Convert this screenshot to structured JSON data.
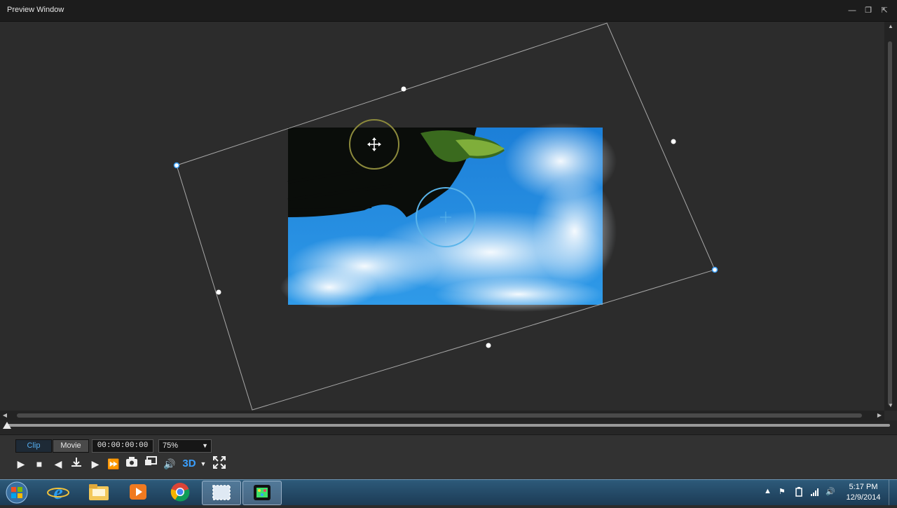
{
  "window": {
    "title": "Preview Window",
    "controls": {
      "minimize": "—",
      "restore": "❐",
      "undock": "⇱"
    }
  },
  "scrollbars": {
    "up": "▲",
    "down": "▼",
    "left": "◀",
    "right": "▶"
  },
  "playback": {
    "clip_label": "Clip",
    "movie_label": "Movie",
    "timecode": "00:00:00:00",
    "zoom_value": "75%",
    "zoom_arrow": "▼",
    "buttons": {
      "play": "▶",
      "stop": "■",
      "prev_frame": "◀",
      "next_frame": "▶",
      "fast_forward": "⏩",
      "mode_3d": "3D",
      "dropdown": "▼",
      "fullscreen": "⛶"
    },
    "colors": {
      "accent": "#3aa0ff"
    }
  },
  "taskbar": {
    "time": "5:17 PM",
    "date": "12/9/2014",
    "tray": {
      "expand": "▲",
      "flag": "⚑",
      "speaker": "🔊"
    }
  }
}
